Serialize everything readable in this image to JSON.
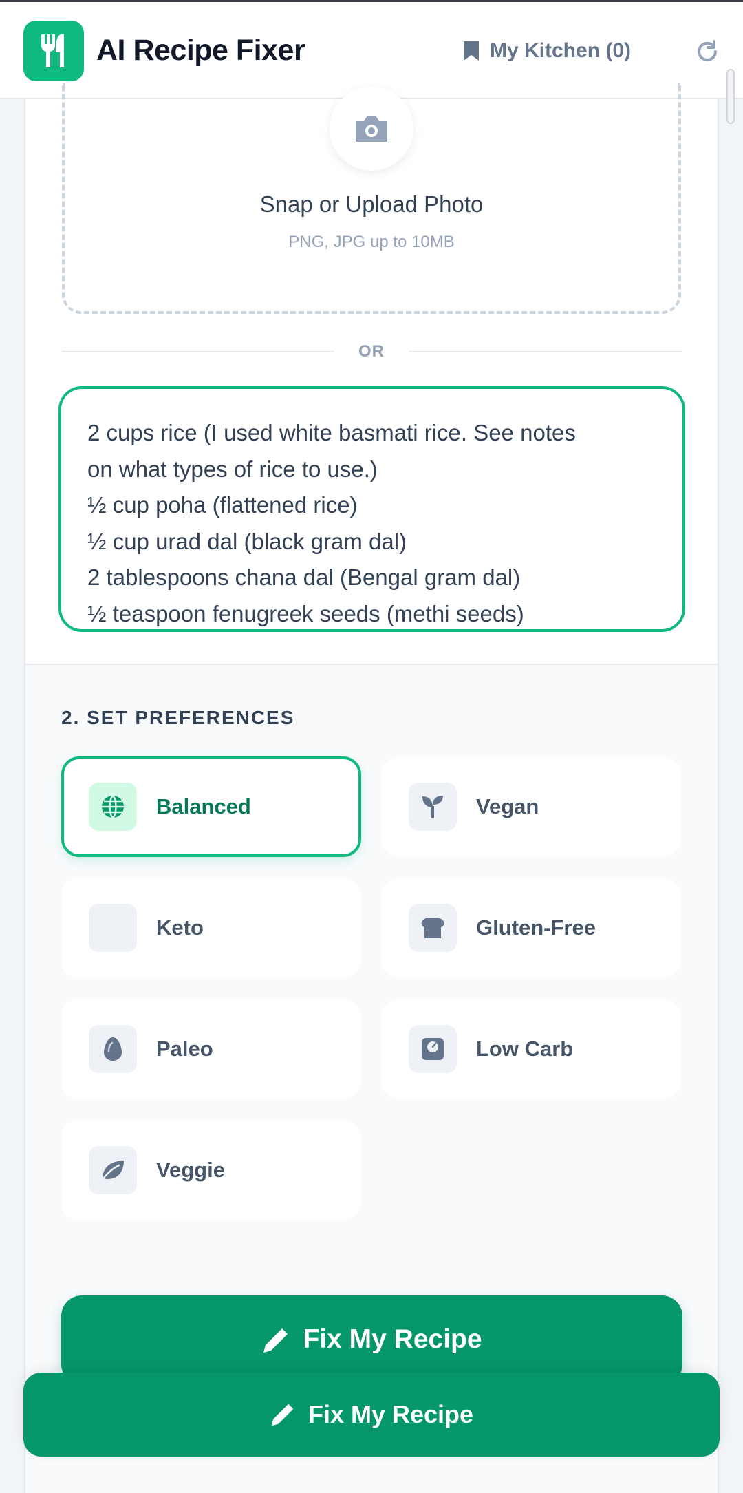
{
  "header": {
    "title": "AI Recipe Fixer",
    "kitchen_label": "My Kitchen (0)"
  },
  "upload": {
    "title": "Snap or Upload Photo",
    "hint": "PNG, JPG up to 10MB",
    "divider": "OR"
  },
  "recipe_text": {
    "lines": [
      "2 cups rice (I used white basmati rice. See notes",
      "on what types of rice to use.)",
      "½ cup poha (flattened rice)",
      "½ cup urad dal (black gram dal)",
      "2 tablespoons chana dal (Bengal gram dal)",
      "½ teaspoon fenugreek seeds (methi seeds)"
    ]
  },
  "preferences": {
    "section_label": "2. SET PREFERENCES",
    "selected": "Balanced",
    "options": [
      {
        "label": "Balanced",
        "icon": "globe-icon"
      },
      {
        "label": "Vegan",
        "icon": "sprout-icon"
      },
      {
        "label": "Keto",
        "icon": "blank-icon"
      },
      {
        "label": "Gluten-Free",
        "icon": "bread-icon"
      },
      {
        "label": "Paleo",
        "icon": "egg-icon"
      },
      {
        "label": "Low Carb",
        "icon": "scale-icon"
      },
      {
        "label": "Veggie",
        "icon": "leaf-icon"
      }
    ]
  },
  "actions": {
    "fix_label": "Fix My Recipe",
    "sticky_fix_label": "Fix My Recipe"
  },
  "colors": {
    "accent": "#10b981",
    "button": "#059669",
    "selected_text": "#047857"
  }
}
